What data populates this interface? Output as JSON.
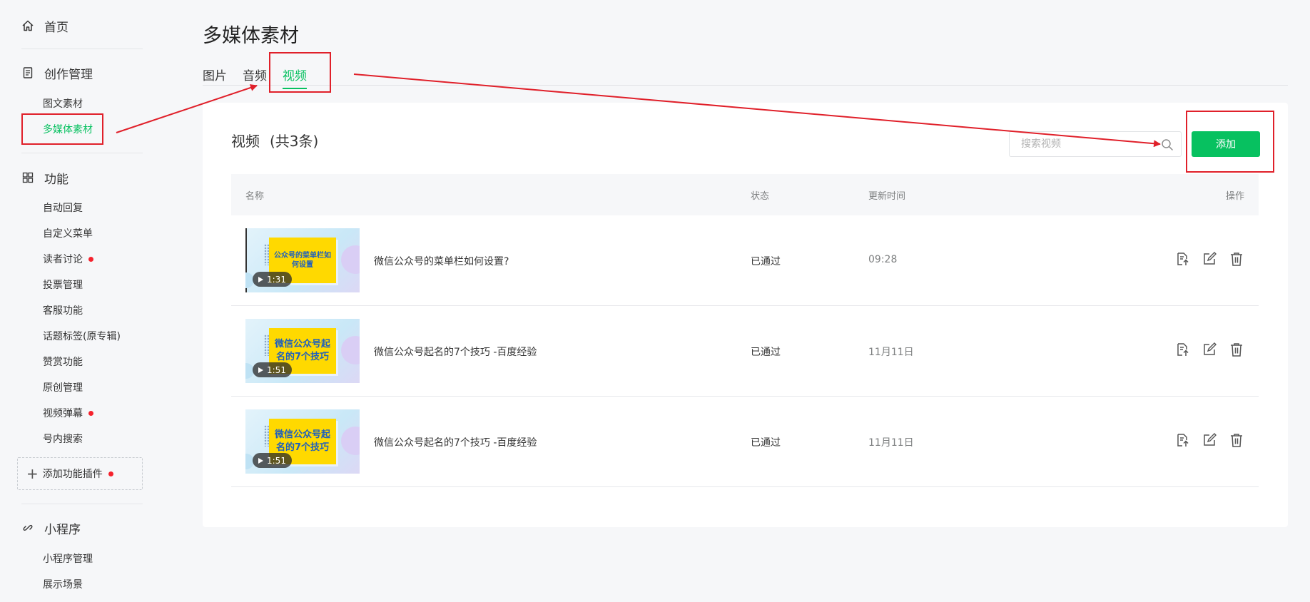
{
  "sidebar": {
    "home": "首页",
    "creation": {
      "title": "创作管理",
      "items": [
        "图文素材",
        "多媒体素材"
      ]
    },
    "features": {
      "title": "功能",
      "items": [
        "自动回复",
        "自定义菜单",
        "读者讨论",
        "投票管理",
        "客服功能",
        "话题标签(原专辑)",
        "赞赏功能",
        "原创管理",
        "视频弹幕",
        "号内搜索"
      ]
    },
    "add_plugin": "添加功能插件",
    "miniprogram": {
      "title": "小程序",
      "items": [
        "小程序管理",
        "展示场景"
      ]
    }
  },
  "page": {
    "title": "多媒体素材",
    "tabs": [
      "图片",
      "音频",
      "视频"
    ],
    "active_tab": "视频"
  },
  "content": {
    "section_title": "视频",
    "count_label": "(共3条)",
    "search_placeholder": "搜索视频",
    "add_label": "添加",
    "columns": {
      "name": "名称",
      "status": "状态",
      "time": "更新时间",
      "ops": "操作"
    },
    "rows": [
      {
        "thumb_text": "公众号的菜单栏如何设置",
        "duration": "1:31",
        "name": "微信公众号的菜单栏如何设置?",
        "status": "已通过",
        "time": "09:28"
      },
      {
        "thumb_text": "微信公众号起名的7个技巧",
        "duration": "1:51",
        "name": "微信公众号起名的7个技巧 -百度经验",
        "status": "已通过",
        "time": "11月11日"
      },
      {
        "thumb_text": "微信公众号起名的7个技巧",
        "duration": "1:51",
        "name": "微信公众号起名的7个技巧 -百度经验",
        "status": "已通过",
        "time": "11月11日"
      }
    ]
  },
  "colors": {
    "accent": "#07c160",
    "annotation": "#e0202a",
    "badge": "#f5222d"
  }
}
